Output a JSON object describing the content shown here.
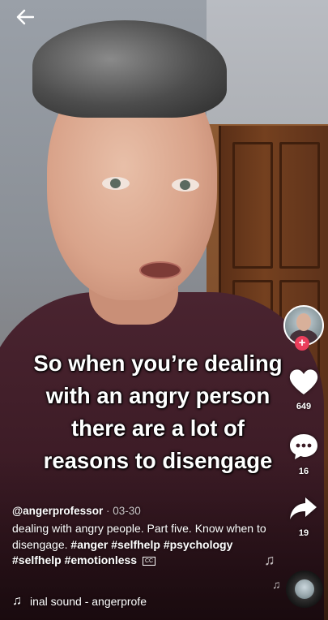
{
  "nav": {
    "back_icon": "arrow-left-icon"
  },
  "caption": {
    "lines": [
      "So when you’re dealing",
      "with an angry person",
      "there are a lot of",
      "reasons to disengage"
    ]
  },
  "rail": {
    "avatar_icon": "creator-avatar",
    "follow_icon": "plus-icon",
    "follow_symbol": "+",
    "like_icon": "heart-icon",
    "like_count": "649",
    "comment_icon": "comment-bubble-icon",
    "comment_count": "16",
    "share_icon": "share-arrow-icon",
    "share_count": "19",
    "music_disc_icon": "spinning-disc-icon",
    "note_symbol": "♫",
    "accent_color": "#ea3e5b"
  },
  "post": {
    "username": "@angerprofessor",
    "date": "03-30",
    "date_separator": " · ",
    "description": "dealing with angry people. Part five. Know when to disengage.",
    "hashtags": [
      "#anger",
      "#selfhelp",
      "#psychology",
      "#selfhelp",
      "#emotionless"
    ],
    "cc_badge": "CC",
    "sound_icon": "music-note-icon",
    "sound_symbol": "♫",
    "sound_text": "inal sound - angerprofe"
  }
}
